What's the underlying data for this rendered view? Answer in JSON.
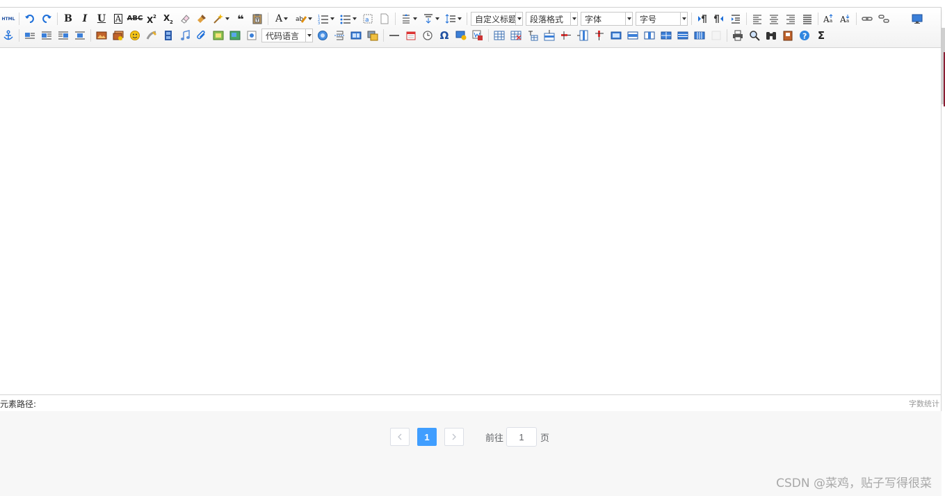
{
  "toolbar": {
    "html_label": "HTML",
    "code_language": "代码语言",
    "custom_heading": "自定义标题",
    "paragraph_format": "段落格式",
    "font_family": "字体",
    "font_size": "字号",
    "bold": "B",
    "italic": "I",
    "underline": "U",
    "font_border": "A",
    "strikethrough": "ABC",
    "quote": "❝",
    "font_color": "A",
    "omega": "Ω",
    "sigma": "Σ"
  },
  "statusbar": {
    "element_path_label": "元素路径:",
    "word_count_label": "字数统计"
  },
  "pagination": {
    "current_page": "1",
    "goto_label": "前往",
    "goto_value": "1",
    "page_unit": "页"
  },
  "watermark": "CSDN @菜鸡，贴子写得很菜",
  "colors": {
    "accent": "#409eff",
    "toolbar_icon_blue": "#1e6fd9"
  }
}
